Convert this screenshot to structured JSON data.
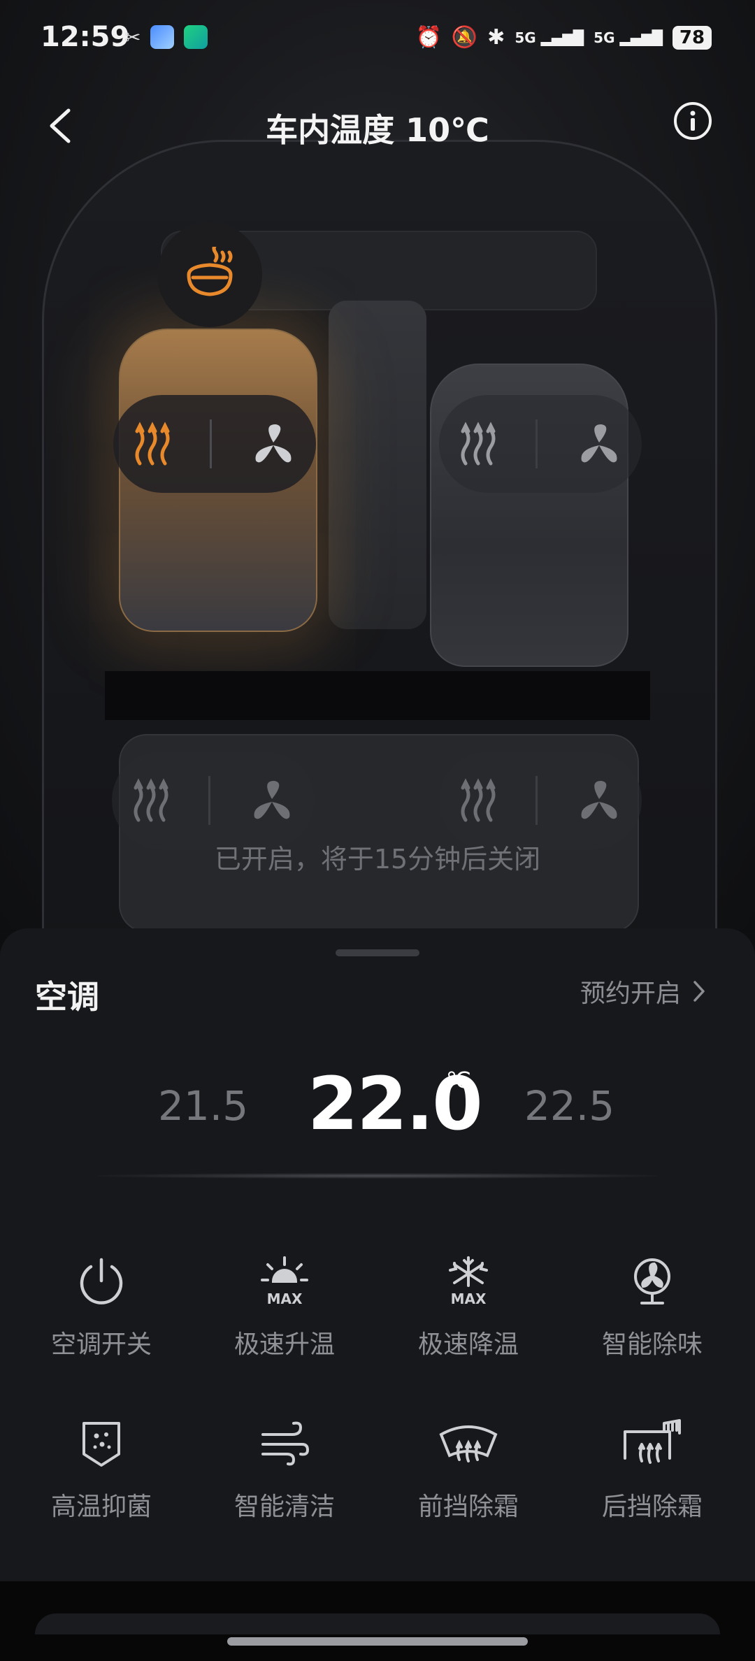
{
  "status_bar": {
    "time": "12:59",
    "battery": "78",
    "signal_1": "5G",
    "signal_2": "5G",
    "icons": [
      "link-icon",
      "app-icon-1",
      "app-icon-2",
      "alarm-icon",
      "mute-icon",
      "bluetooth-icon"
    ]
  },
  "header": {
    "title": "车内温度 10℃"
  },
  "car": {
    "note": "已开启，将于15分钟后关闭",
    "accent": "#e8892c"
  },
  "sheet": {
    "title": "空调",
    "schedule_label": "预约开启",
    "temp_prev": "21.5",
    "temp_current": "22.0",
    "temp_unit": "℃",
    "temp_next": "22.5",
    "functions": [
      {
        "label": "空调开关",
        "icon": "power-icon"
      },
      {
        "label": "极速升温",
        "icon": "max-heat-icon"
      },
      {
        "label": "极速降温",
        "icon": "max-cool-icon"
      },
      {
        "label": "智能除味",
        "icon": "deodorize-icon"
      },
      {
        "label": "高温抑菌",
        "icon": "sterilize-icon"
      },
      {
        "label": "智能清洁",
        "icon": "clean-icon"
      },
      {
        "label": "前挡除霜",
        "icon": "front-defrost-icon"
      },
      {
        "label": "后挡除霜",
        "icon": "rear-defrost-icon"
      }
    ]
  }
}
